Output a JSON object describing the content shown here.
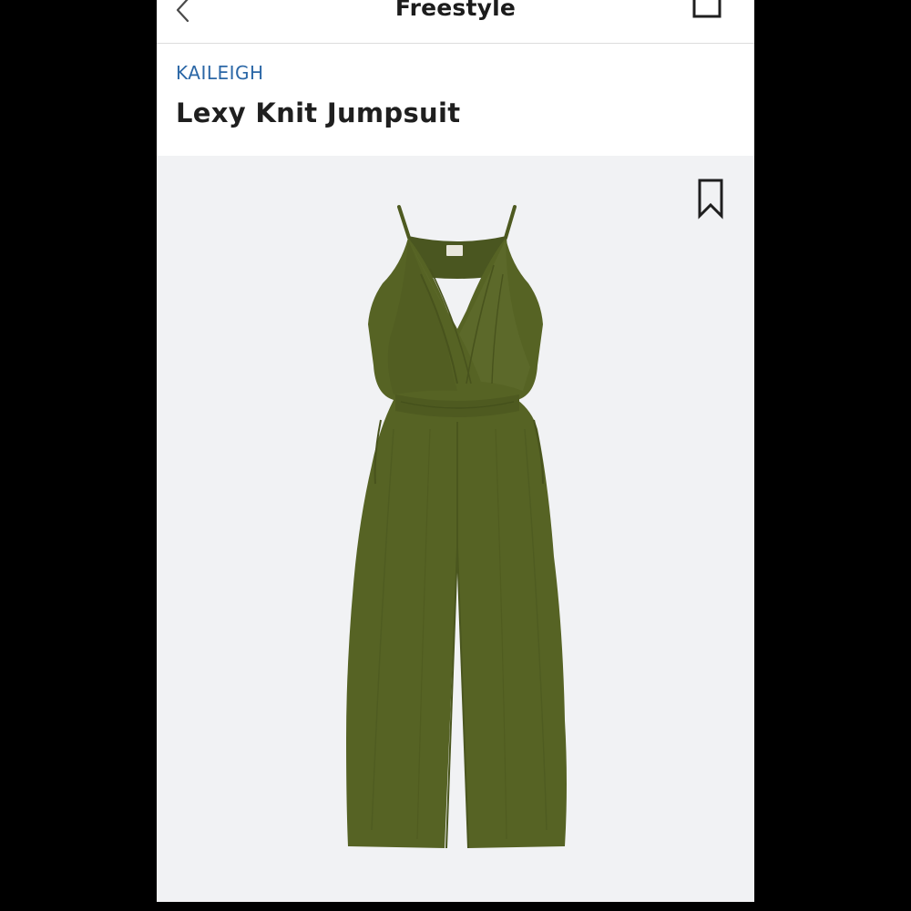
{
  "navbar": {
    "title": "Freestyle",
    "back_icon": "chevron-left-icon",
    "cart_icon": "bag-icon"
  },
  "product": {
    "brand": "KAILEIGH",
    "name": "Lexy Knit Jumpsuit",
    "save_icon": "bookmark-icon",
    "garment_color": "#566324"
  },
  "colors": {
    "brand_text": "#2b67a6",
    "image_background": "#f1f2f4"
  }
}
